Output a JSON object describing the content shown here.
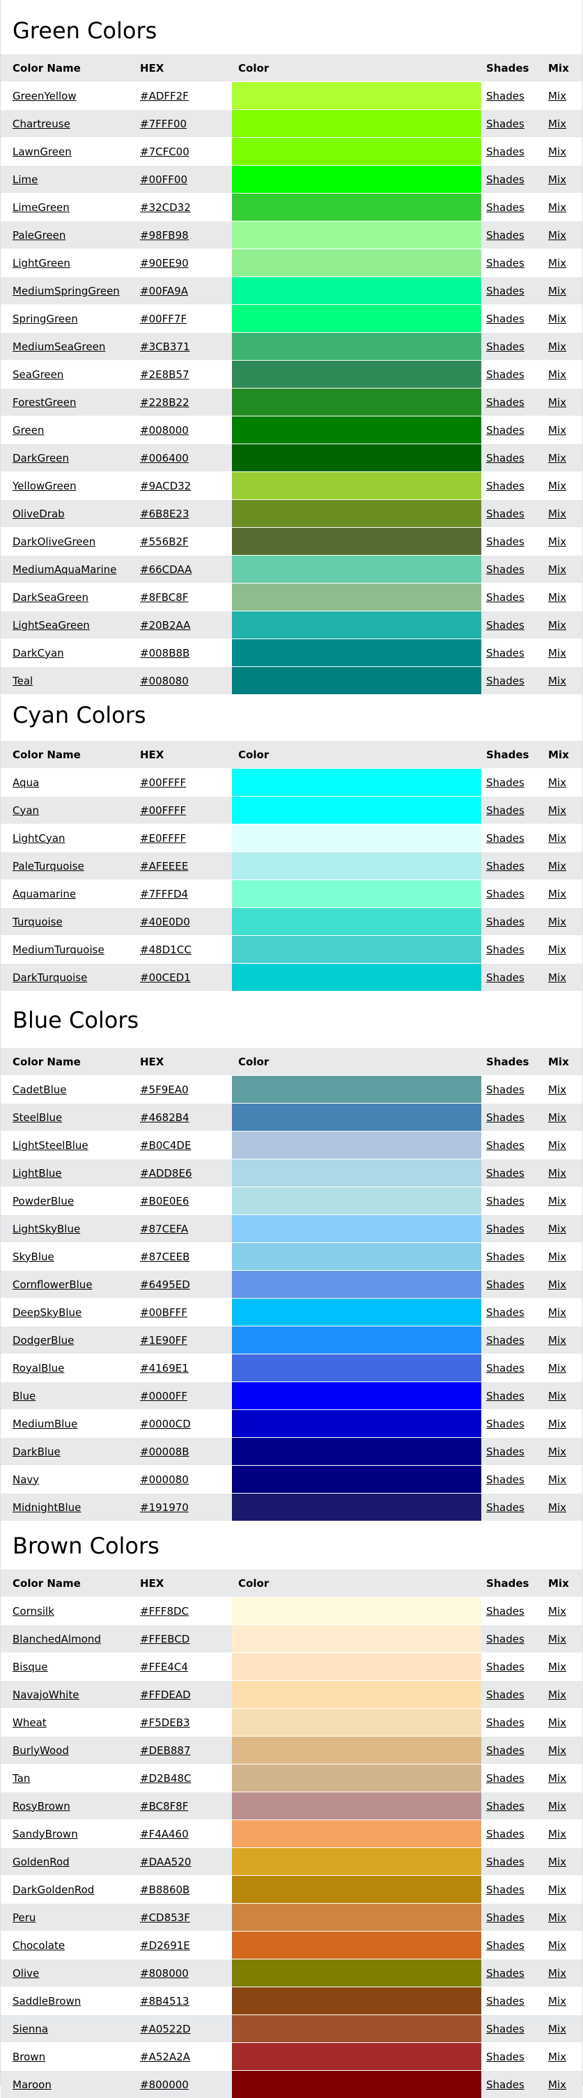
{
  "labels": {
    "name": "Color Name",
    "hex": "HEX",
    "color": "Color",
    "shades": "Shades",
    "mix": "Mix",
    "shades_link": "Shades",
    "mix_link": "Mix"
  },
  "sections": [
    {
      "key": "green",
      "title": "Green Colors",
      "rows": [
        {
          "name": "GreenYellow",
          "hex": "#ADFF2F"
        },
        {
          "name": "Chartreuse",
          "hex": "#7FFF00"
        },
        {
          "name": "LawnGreen",
          "hex": "#7CFC00"
        },
        {
          "name": "Lime",
          "hex": "#00FF00"
        },
        {
          "name": "LimeGreen",
          "hex": "#32CD32"
        },
        {
          "name": "PaleGreen",
          "hex": "#98FB98"
        },
        {
          "name": "LightGreen",
          "hex": "#90EE90"
        },
        {
          "name": "MediumSpringGreen",
          "hex": "#00FA9A"
        },
        {
          "name": "SpringGreen",
          "hex": "#00FF7F"
        },
        {
          "name": "MediumSeaGreen",
          "hex": "#3CB371"
        },
        {
          "name": "SeaGreen",
          "hex": "#2E8B57"
        },
        {
          "name": "ForestGreen",
          "hex": "#228B22"
        },
        {
          "name": "Green",
          "hex": "#008000"
        },
        {
          "name": "DarkGreen",
          "hex": "#006400"
        },
        {
          "name": "YellowGreen",
          "hex": "#9ACD32"
        },
        {
          "name": "OliveDrab",
          "hex": "#6B8E23"
        },
        {
          "name": "DarkOliveGreen",
          "hex": "#556B2F"
        },
        {
          "name": "MediumAquaMarine",
          "hex": "#66CDAA"
        },
        {
          "name": "DarkSeaGreen",
          "hex": "#8FBC8F"
        },
        {
          "name": "LightSeaGreen",
          "hex": "#20B2AA"
        },
        {
          "name": "DarkCyan",
          "hex": "#008B8B"
        },
        {
          "name": "Teal",
          "hex": "#008080"
        }
      ]
    },
    {
      "key": "cyan",
      "title": "Cyan Colors",
      "rows": [
        {
          "name": "Aqua",
          "hex": "#00FFFF"
        },
        {
          "name": "Cyan",
          "hex": "#00FFFF"
        },
        {
          "name": "LightCyan",
          "hex": "#E0FFFF"
        },
        {
          "name": "PaleTurquoise",
          "hex": "#AFEEEE"
        },
        {
          "name": "Aquamarine",
          "hex": "#7FFFD4"
        },
        {
          "name": "Turquoise",
          "hex": "#40E0D0"
        },
        {
          "name": "MediumTurquoise",
          "hex": "#48D1CC"
        },
        {
          "name": "DarkTurquoise",
          "hex": "#00CED1"
        }
      ]
    },
    {
      "key": "blue",
      "title": "Blue Colors",
      "rows": [
        {
          "name": "CadetBlue",
          "hex": "#5F9EA0"
        },
        {
          "name": "SteelBlue",
          "hex": "#4682B4"
        },
        {
          "name": "LightSteelBlue",
          "hex": "#B0C4DE"
        },
        {
          "name": "LightBlue",
          "hex": "#ADD8E6"
        },
        {
          "name": "PowderBlue",
          "hex": "#B0E0E6"
        },
        {
          "name": "LightSkyBlue",
          "hex": "#87CEFA"
        },
        {
          "name": "SkyBlue",
          "hex": "#87CEEB"
        },
        {
          "name": "CornflowerBlue",
          "hex": "#6495ED"
        },
        {
          "name": "DeepSkyBlue",
          "hex": "#00BFFF"
        },
        {
          "name": "DodgerBlue",
          "hex": "#1E90FF"
        },
        {
          "name": "RoyalBlue",
          "hex": "#4169E1"
        },
        {
          "name": "Blue",
          "hex": "#0000FF"
        },
        {
          "name": "MediumBlue",
          "hex": "#0000CD"
        },
        {
          "name": "DarkBlue",
          "hex": "#00008B"
        },
        {
          "name": "Navy",
          "hex": "#000080"
        },
        {
          "name": "MidnightBlue",
          "hex": "#191970"
        }
      ]
    },
    {
      "key": "brown",
      "title": "Brown Colors",
      "rows": [
        {
          "name": "Cornsilk",
          "hex": "#FFF8DC"
        },
        {
          "name": "BlanchedAlmond",
          "hex": "#FFEBCD"
        },
        {
          "name": "Bisque",
          "hex": "#FFE4C4"
        },
        {
          "name": "NavajoWhite",
          "hex": "#FFDEAD"
        },
        {
          "name": "Wheat",
          "hex": "#F5DEB3"
        },
        {
          "name": "BurlyWood",
          "hex": "#DEB887"
        },
        {
          "name": "Tan",
          "hex": "#D2B48C"
        },
        {
          "name": "RosyBrown",
          "hex": "#BC8F8F"
        },
        {
          "name": "SandyBrown",
          "hex": "#F4A460"
        },
        {
          "name": "GoldenRod",
          "hex": "#DAA520"
        },
        {
          "name": "DarkGoldenRod",
          "hex": "#B8860B"
        },
        {
          "name": "Peru",
          "hex": "#CD853F"
        },
        {
          "name": "Chocolate",
          "hex": "#D2691E"
        },
        {
          "name": "Olive",
          "hex": "#808000"
        },
        {
          "name": "SaddleBrown",
          "hex": "#8B4513"
        },
        {
          "name": "Sienna",
          "hex": "#A0522D"
        },
        {
          "name": "Brown",
          "hex": "#A52A2A"
        },
        {
          "name": "Maroon",
          "hex": "#800000"
        }
      ]
    }
  ]
}
